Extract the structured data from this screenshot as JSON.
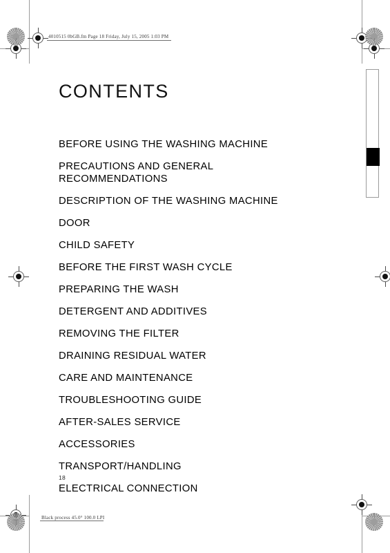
{
  "document": {
    "title": "CONTENTS",
    "page_number": "18",
    "header_slug": "4010515 0bGB.fm  Page 18  Friday, July 15, 2005  1:03 PM",
    "footer_slug": "Black process 45.0° 100.0 LPI"
  },
  "contents": {
    "items": [
      {
        "label": "BEFORE USING THE WASHING MACHINE"
      },
      {
        "label": "PRECAUTIONS AND GENERAL\nRECOMMENDATIONS"
      },
      {
        "label": "DESCRIPTION OF THE WASHING MACHINE"
      },
      {
        "label": "DOOR"
      },
      {
        "label": "CHILD SAFETY"
      },
      {
        "label": "BEFORE THE FIRST WASH CYCLE"
      },
      {
        "label": "PREPARING THE WASH"
      },
      {
        "label": "DETERGENT AND ADDITIVES"
      },
      {
        "label": "REMOVING THE FILTER"
      },
      {
        "label": "DRAINING RESIDUAL WATER"
      },
      {
        "label": "CARE AND MAINTENANCE"
      },
      {
        "label": "TROUBLESHOOTING GUIDE"
      },
      {
        "label": "AFTER-SALES SERVICE"
      },
      {
        "label": "ACCESSORIES"
      },
      {
        "label": "TRANSPORT/HANDLING"
      },
      {
        "label": "ELECTRICAL CONNECTION"
      }
    ]
  },
  "thumb_index": {
    "marker_color": "#000000",
    "outline_color": "#9a9a9a"
  },
  "print_marks": {
    "registration_icon": "registration-target-icon",
    "halftone_icon": "halftone-density-patch-icon",
    "trim_line_color": "#9a9a9a"
  },
  "colors": {
    "page_background": "#ffffff",
    "text": "#000000",
    "slug_text": "#3a3a3a"
  }
}
